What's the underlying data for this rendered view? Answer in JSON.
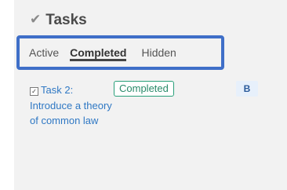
{
  "header": {
    "icon": "check-icon",
    "title": "Tasks"
  },
  "tabs": [
    {
      "label": "Active",
      "selected": false
    },
    {
      "label": "Completed",
      "selected": true
    },
    {
      "label": "Hidden",
      "selected": false
    }
  ],
  "task": {
    "icon": "checkbox-checked-icon",
    "label": "Task 2: Introduce a theory of common law",
    "status": "Completed",
    "grade": "B"
  },
  "colors": {
    "highlight_border": "#3f6fc8",
    "link": "#2f78c4",
    "status_border": "#2aa07a"
  }
}
